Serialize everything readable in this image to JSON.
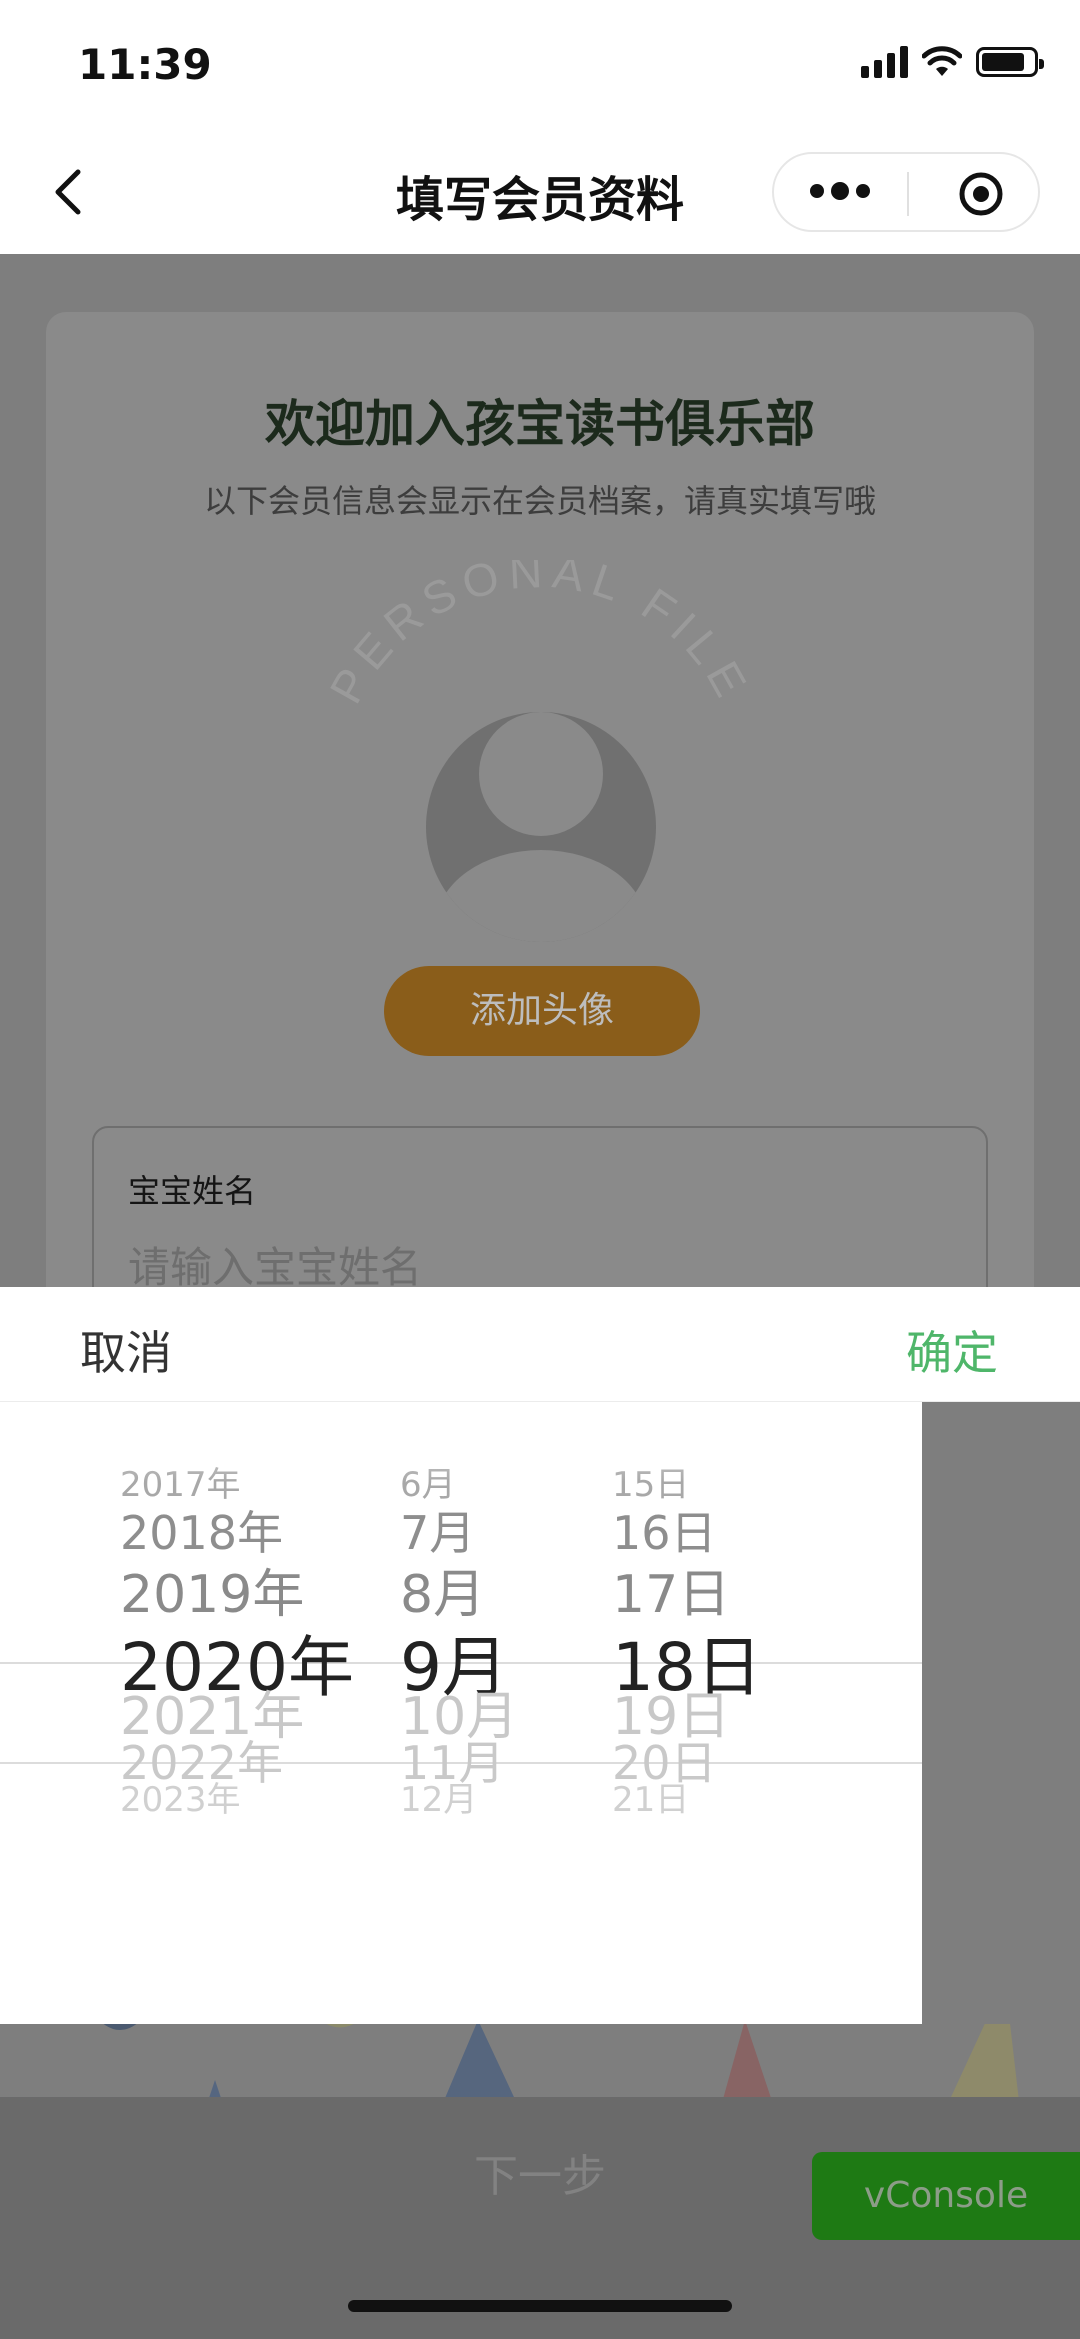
{
  "status_bar": {
    "time": "11:39"
  },
  "nav": {
    "title": "填写会员资料"
  },
  "card": {
    "welcome": "欢迎加入孩宝读书俱乐部",
    "subtitle": "以下会员信息会显示在会员档案，请真实填写哦",
    "personal_file": "PERSONAL FILE",
    "add_avatar": "添加头像",
    "name_label": "宝宝姓名",
    "name_placeholder": "请输入宝宝姓名"
  },
  "picker": {
    "cancel": "取消",
    "confirm": "确定",
    "years": [
      "2017年",
      "2018年",
      "2019年",
      "2020年",
      "2021年",
      "2022年",
      "2023年"
    ],
    "months": [
      "6月",
      "7月",
      "8月",
      "9月",
      "10月",
      "11月",
      "12月"
    ],
    "days": [
      "15日",
      "16日",
      "17日",
      "18日",
      "19日",
      "20日",
      "21日"
    ],
    "selected": {
      "year": "2020年",
      "month": "9月",
      "day": "18日"
    }
  },
  "bottom": {
    "next": "下一步",
    "vconsole": "vConsole"
  },
  "colors": {
    "confirm": "#4fb66a",
    "vconsole_bg": "#1e7a14",
    "avatar_button": "#8a5d1a"
  }
}
